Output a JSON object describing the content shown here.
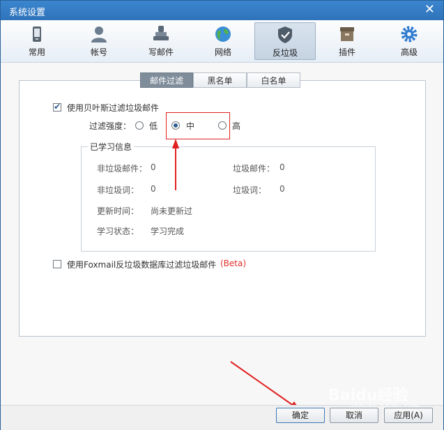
{
  "window": {
    "title": "系统设置"
  },
  "toolbar": {
    "items": [
      {
        "label": "常用",
        "icon": "phone-icon"
      },
      {
        "label": "帐号",
        "icon": "user-icon"
      },
      {
        "label": "写邮件",
        "icon": "stamp-icon"
      },
      {
        "label": "网络",
        "icon": "globe-icon"
      },
      {
        "label": "反垃圾",
        "icon": "shield-icon",
        "active": true
      },
      {
        "label": "插件",
        "icon": "box-icon"
      },
      {
        "label": "高级",
        "icon": "gear-icon"
      }
    ]
  },
  "subtabs": [
    {
      "label": "邮件过滤",
      "active": true
    },
    {
      "label": "黑名单"
    },
    {
      "label": "白名单"
    }
  ],
  "bayes": {
    "label": "使用贝叶斯过滤垃圾邮件",
    "checked": true,
    "strength_label": "过滤强度：",
    "options": [
      "低",
      "中",
      "高"
    ],
    "selected": "中"
  },
  "learned": {
    "title": "已学习信息",
    "non_spam_mail_label": "非垃圾邮件：",
    "non_spam_mail_value": "0",
    "spam_mail_label": "垃圾邮件：",
    "spam_mail_value": "0",
    "non_spam_word_label": "非垃圾词：",
    "non_spam_word_value": "0",
    "spam_word_label": "垃圾词：",
    "spam_word_value": "0",
    "update_time_label": "更新时间：",
    "update_time_value": "尚未更新过",
    "status_label": "学习状态：",
    "status_value": "学习完成"
  },
  "foxmail_db": {
    "label": "使用Foxmail反垃圾数据库过滤垃圾邮件",
    "beta": "(Beta)",
    "checked": false
  },
  "footer": {
    "ok": "确定",
    "cancel": "取消",
    "apply": "应用(A)"
  },
  "watermark": {
    "text": "Baidu经验",
    "sub": "jingyan.baidu.com"
  },
  "colors": {
    "accent": "#2f73ba",
    "annotation": "#e02020"
  }
}
